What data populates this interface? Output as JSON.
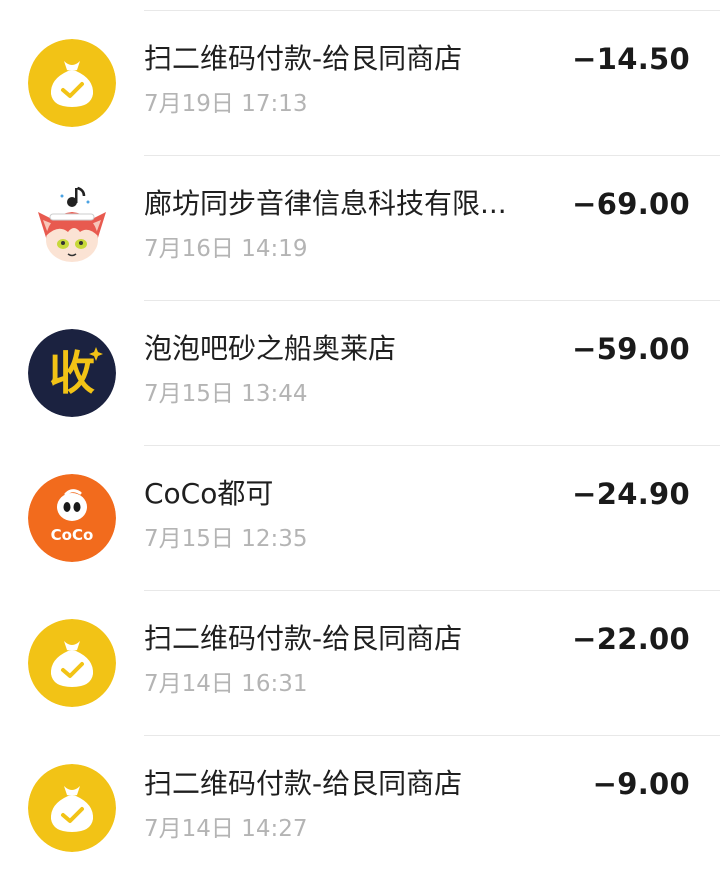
{
  "transactions": [
    {
      "icon": "money-bag-icon",
      "title": "扫二维码付款-给艮同商店",
      "time": "7月19日 17:13",
      "amount": "−14.50",
      "color": "#F2C316"
    },
    {
      "icon": "anime-cat-girl-avatar-icon",
      "title": "廊坊同步音律信息科技有限...",
      "time": "7月16日 14:19",
      "amount": "−69.00",
      "color": "#E85A4F"
    },
    {
      "icon": "shou-collect-icon",
      "title": "泡泡吧砂之船奥莱店",
      "time": "7月15日 13:44",
      "amount": "−59.00",
      "color": "#1B2240"
    },
    {
      "icon": "coco-logo-icon",
      "title": "CoCo都可",
      "time": "7月15日 12:35",
      "amount": "−24.90",
      "color": "#F26B1D"
    },
    {
      "icon": "money-bag-icon",
      "title": "扫二维码付款-给艮同商店",
      "time": "7月14日 16:31",
      "amount": "−22.00",
      "color": "#F2C316"
    },
    {
      "icon": "money-bag-icon",
      "title": "扫二维码付款-给艮同商店",
      "time": "7月14日 14:27",
      "amount": "−9.00",
      "color": "#F2C316"
    }
  ],
  "shou_glyph": "收",
  "coco_label": "CoCo"
}
